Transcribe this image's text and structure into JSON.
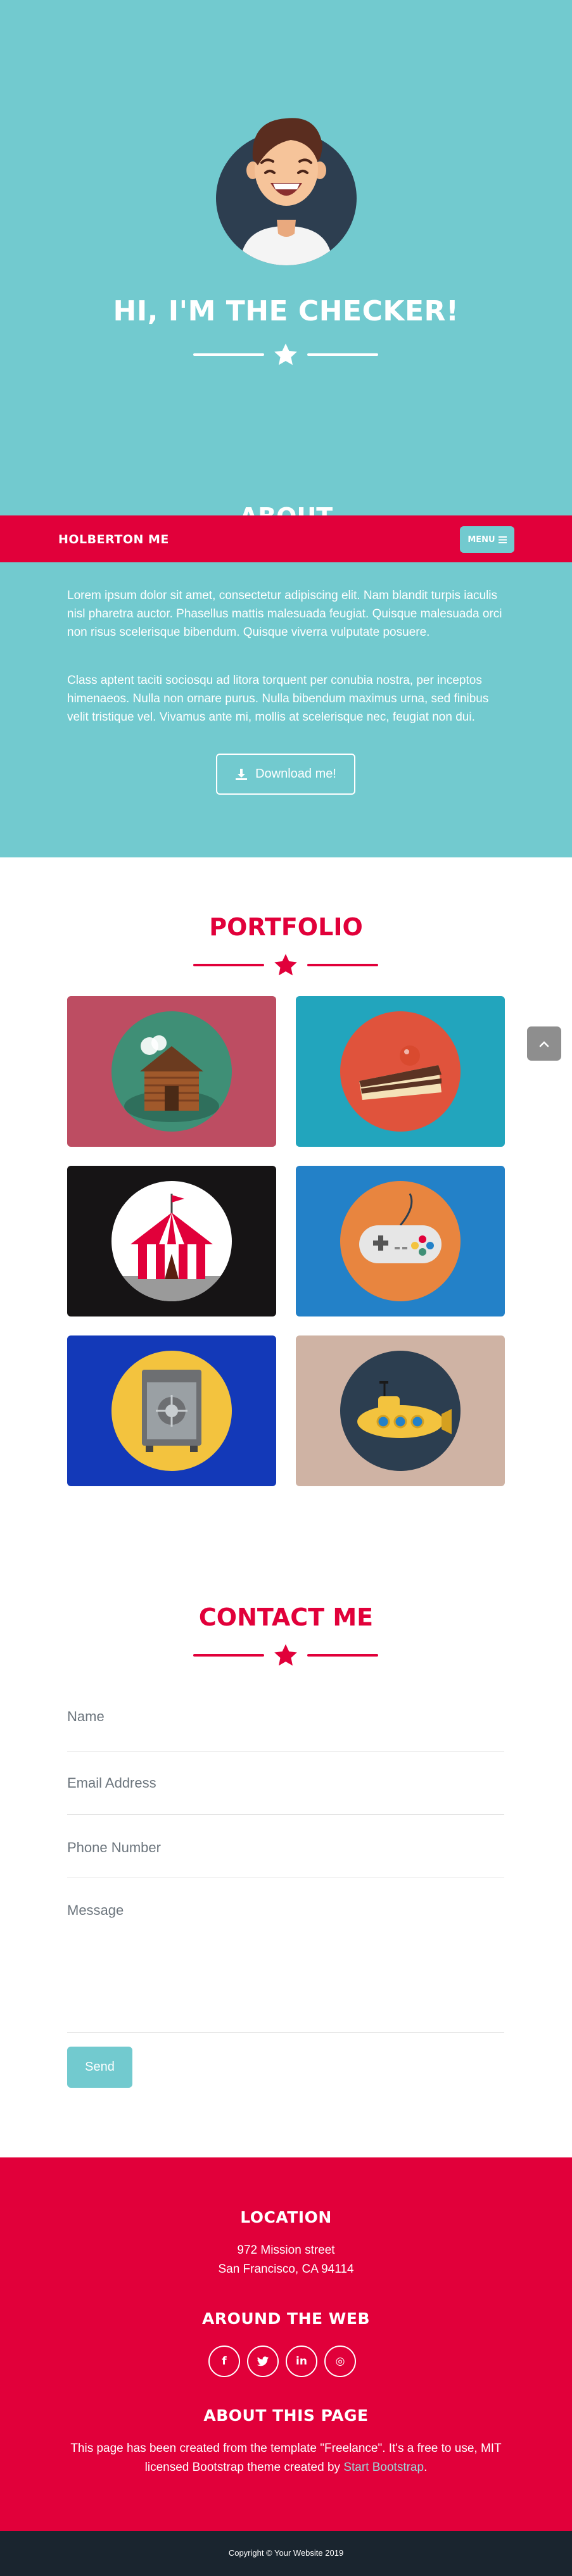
{
  "colors": {
    "accent_red": "#e1003a",
    "masthead_teal": "#72cacf",
    "footer_dark": "#1a252f",
    "white": "#ffffff"
  },
  "navbar": {
    "brand": "HOLBERTON ME",
    "menu_label": "MENU",
    "menu_icon": "hamburger-icon"
  },
  "masthead": {
    "avatar": "avatar-illustration",
    "title": "HI, I'M THE CHECKER!",
    "divider_icon": "star-icon"
  },
  "about": {
    "title": "ABOUT",
    "paragraph_1": "Lorem ipsum dolor sit amet, consectetur adipiscing elit. Nam blandit turpis iaculis nisl pharetra auctor. Phasellus mattis malesuada feugiat. Quisque malesuada orci non risus scelerisque bibendum. Quisque viverra vulputate posuere.",
    "paragraph_2": "Class aptent taciti sociosqu ad litora torquent per conubia nostra, per inceptos himenaeos. Nulla non ornare purus. Nulla bibendum maximus urna, sed finibus velit tristique vel. Vivamus ante mi, mollis at scelerisque nec, feugiat non dui.",
    "download_label": "Download me!",
    "download_icon": "download-icon"
  },
  "portfolio": {
    "title": "PORTFOLIO",
    "items": [
      {
        "icon": "cabin-icon",
        "bg": "#bd4d62",
        "circle": "#3f8f76"
      },
      {
        "icon": "cake-icon",
        "bg": "#22a5bd",
        "circle": "#e0533c"
      },
      {
        "icon": "circus-tent-icon",
        "bg": "#161415",
        "circle": "#ffffff"
      },
      {
        "icon": "game-controller-icon",
        "bg": "#2381c8",
        "circle": "#e8853f"
      },
      {
        "icon": "safe-icon",
        "bg": "#1339b8",
        "circle": "#f3c33e"
      },
      {
        "icon": "submarine-icon",
        "bg": "#cfb3a4",
        "circle": "#2c3e50"
      }
    ]
  },
  "scroll_top_icon": "chevron-up-icon",
  "contact": {
    "title": "CONTACT ME",
    "name_placeholder": "Name",
    "email_placeholder": "Email Address",
    "phone_placeholder": "Phone Number",
    "message_placeholder": "Message",
    "send_label": "Send"
  },
  "footer": {
    "location_heading": "LOCATION",
    "address_line_1": "972 Mission street",
    "address_line_2": "San Francisco, CA 94114",
    "web_heading": "AROUND THE WEB",
    "social": [
      {
        "icon": "facebook-icon",
        "glyph": "f"
      },
      {
        "icon": "twitter-icon",
        "glyph": "t"
      },
      {
        "icon": "linkedin-icon",
        "glyph": "in"
      },
      {
        "icon": "dribbble-icon",
        "glyph": "◎"
      }
    ],
    "about_heading": "ABOUT THIS PAGE",
    "about_line_1": "This page has been created from the template \"Freelance\". It's a free to use, MIT",
    "about_line_2_prefix": "licensed Bootstrap theme created by ",
    "about_link": "Start Bootstrap",
    "about_line_2_suffix": "."
  },
  "copyright": "Copyright © Your Website 2019"
}
